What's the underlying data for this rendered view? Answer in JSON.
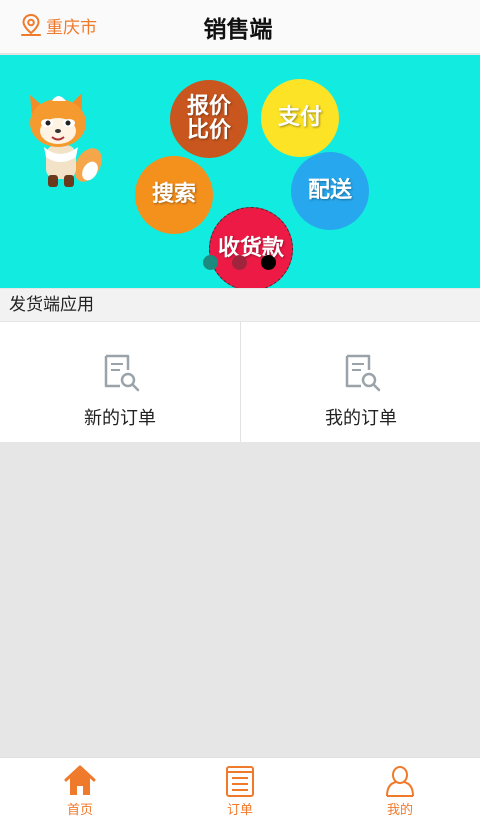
{
  "header": {
    "location": "重庆市",
    "title": "销售端"
  },
  "banner": {
    "bubbles": {
      "quote_line1": "报价",
      "quote_line2": "比价",
      "pay": "支付",
      "search": "搜索",
      "ship": "配送",
      "collect": "收货款"
    },
    "active_slide": 3,
    "slide_count": 3
  },
  "section": {
    "label": "发货端应用"
  },
  "apps": [
    {
      "label": "新的订单",
      "icon": "order-search-icon"
    },
    {
      "label": "我的订单",
      "icon": "order-search-icon"
    }
  ],
  "tabbar": {
    "items": [
      {
        "label": "首页",
        "icon": "home-icon",
        "active": true
      },
      {
        "label": "订单",
        "icon": "document-icon",
        "active": false
      },
      {
        "label": "我的",
        "icon": "user-icon",
        "active": false
      }
    ]
  },
  "colors": {
    "accent": "#f07a2c",
    "banner_bg": "#12ece0"
  }
}
